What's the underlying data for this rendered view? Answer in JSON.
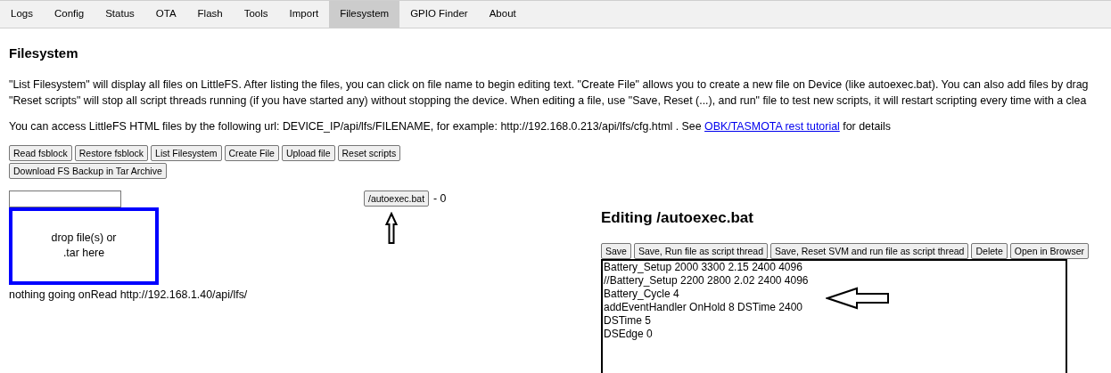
{
  "tabs": [
    {
      "label": "Logs",
      "selected": false
    },
    {
      "label": "Config",
      "selected": false
    },
    {
      "label": "Status",
      "selected": false
    },
    {
      "label": "OTA",
      "selected": false
    },
    {
      "label": "Flash",
      "selected": false
    },
    {
      "label": "Tools",
      "selected": false
    },
    {
      "label": "Import",
      "selected": false
    },
    {
      "label": "Filesystem",
      "selected": true
    },
    {
      "label": "GPIO Finder",
      "selected": false
    },
    {
      "label": "About",
      "selected": false
    }
  ],
  "heading": "Filesystem",
  "intro_lines": [
    "\"List Filesystem\" will display all files on LittleFS. After listing the files, you can click on file name to begin editing text. \"Create File\" allows you to create a new file on Device (like autoexec.bat). You can also add files by drag",
    "\"Reset scripts\" will stop all script threads running (if you have started any) without stopping the device. When editing a file, use \"Save, Reset (...), and run\" file to test new scripts, it will restart scripting every time with a clea"
  ],
  "access_note": {
    "before": "You can access LittleFS HTML files by the following url: DEVICE_IP/api/lfs/FILENAME, for example: http://192.168.0.213/api/lfs/cfg.html . See",
    "link": "OBK/TASMOTA rest tutorial",
    "after": "for details"
  },
  "toolbar": [
    "Read fsblock",
    "Restore fsblock",
    "List Filesystem",
    "Create File",
    "Upload file",
    "Reset scripts",
    "Download FS Backup in Tar Archive"
  ],
  "drop_zone": [
    "drop file(s) or",
    ".tar here"
  ],
  "status": "nothing going onRead http://192.168.1.40/api/lfs/",
  "files": [
    {
      "name": "/autoexec.bat",
      "size": "- 0"
    }
  ],
  "editor": {
    "title": "Editing /autoexec.bat",
    "buttons": [
      "Save",
      "Save, Run file as script thread",
      "Save, Reset SVM and run file as script thread",
      "Delete",
      "Open in Browser"
    ],
    "lines": [
      "Battery_Setup 2000 3300 2.15 2400 4096",
      "//Battery_Setup 2200 2800 2.02 2400 4096",
      "Battery_Cycle 4",
      "addEventHandler OnHold 8 DSTime 2400",
      "DSTime 5",
      "DSEdge 0"
    ]
  }
}
